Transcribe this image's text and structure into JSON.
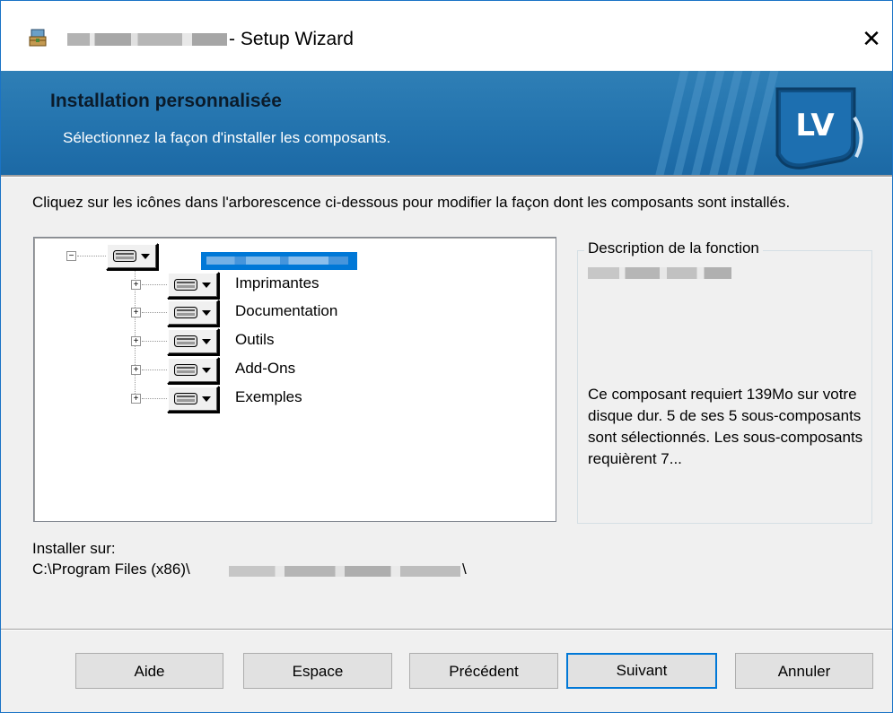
{
  "window": {
    "title": "- Setup Wizard",
    "close_glyph": "✕",
    "accent_color": "#0078d7"
  },
  "banner": {
    "title": "Installation personnalisée",
    "subtitle": "Sélectionnez la façon d'installer les composants.",
    "logo_text": "LV",
    "background_color": "#2272ad"
  },
  "instruction": "Cliquez sur les icônes dans l'arborescence ci-dessous pour modifier la façon dont les composants sont installés.",
  "tree": {
    "children": [
      {
        "label": "Imprimantes"
      },
      {
        "label": "Documentation"
      },
      {
        "label": "Outils"
      },
      {
        "label": "Add-Ons"
      },
      {
        "label": "Exemples"
      }
    ]
  },
  "description": {
    "legend": "Description de la fonction",
    "text": "Ce composant requiert 139Mo sur votre disque dur. 5 de ses 5 sous-composants sont sélectionnés. Les sous-composants requièrent 7..."
  },
  "install": {
    "label": "Installer sur:",
    "path_prefix": "C:\\Program Files (x86)\\",
    "path_suffix": "\\"
  },
  "buttons": {
    "help": "Aide",
    "space": "Espace",
    "back": "Précédent",
    "next": "Suivant",
    "cancel": "Annuler"
  }
}
